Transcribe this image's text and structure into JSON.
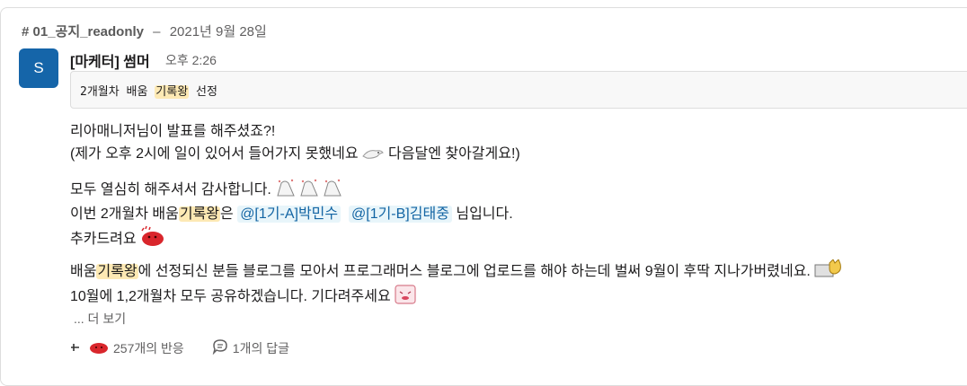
{
  "context": {
    "channel": "# 01_공지_readonly",
    "separator": "–",
    "date": "2021년 9월 28일"
  },
  "message": {
    "avatar_letter": "S",
    "author": "[마케터] 썸머",
    "time": "오후 2:26",
    "code": {
      "pre": "2개월차 배움 ",
      "highlight": "기록왕",
      "post": " 선정"
    },
    "lines": {
      "l1": "리아매니저님이 발표를 해주셨죠?!",
      "l2": "(제가 오후 2시에 일이 있어서 들어가지 못했네요",
      "l2b": " 다음달엔 찾아갈게요!)",
      "l3": "모두 열심히 해주셔서 감사합니다.",
      "l4a": "이번 2개월차 배움",
      "l4hl": "기록왕",
      "l4b": "은 ",
      "mention1": "@[1기-A]박민수",
      "mention2": "@[1기-B]김태중",
      "l4c": " 님입니다.",
      "l5": "추카드려요",
      "l6a": "배움",
      "l6hl": "기록왕",
      "l6b": "에 선정되신 분들 블로그를 모아서 프로그래머스 블로그에 업로드를 해야 하는데 벌써 9월이 후딱 지나가버렸네요.",
      "l7": "10월에 1,2개월차 모두 공유하겠습니다. 기다려주세요"
    },
    "see_more": "... 더 보기",
    "reactions": {
      "count_label": "257개의 반응",
      "replies_label": "1개의 답글"
    }
  },
  "colors": {
    "avatar": "#1565a9",
    "highlight": "#fde9b4",
    "mention_text": "#1264a3",
    "mention_bg": "#e8f5fa"
  }
}
